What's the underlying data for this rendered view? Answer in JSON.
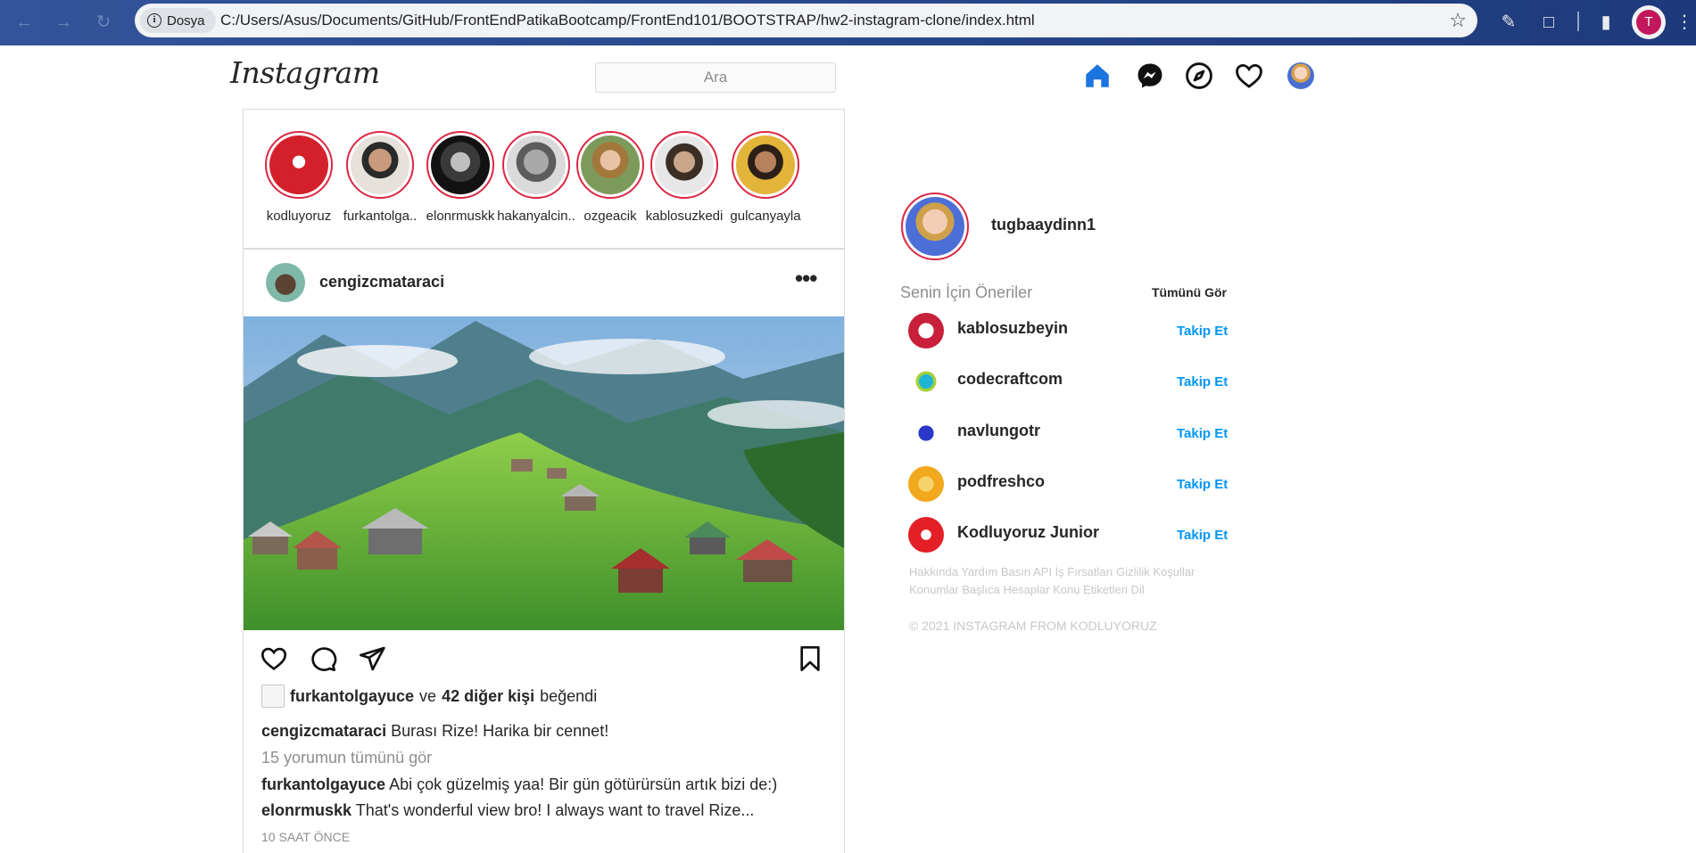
{
  "browser": {
    "site_chip": "Dosya",
    "url": "C:/Users/Asus/Documents/GitHub/FrontEndPatikaBootcamp/FrontEnd101/BOOTSTRAP/hw2-instagram-clone/index.html",
    "profile_initial": "T"
  },
  "header": {
    "logo": "Instagram",
    "search_placeholder": "Ara",
    "icons": [
      "home-icon",
      "messenger-icon",
      "explore-icon",
      "heart-icon",
      "profile-avatar"
    ]
  },
  "stories": [
    {
      "name": "kodluyoruz",
      "color": "#d4202a"
    },
    {
      "name": "furkantolga..",
      "color": "#9a8b7a"
    },
    {
      "name": "elonrmuskk",
      "color": "#2b2b2b"
    },
    {
      "name": "hakanyalcin..",
      "color": "#7d7d7d"
    },
    {
      "name": "ozgeacik",
      "color": "#8fa56a"
    },
    {
      "name": "kablosuzkedi",
      "color": "#6b5a4b"
    },
    {
      "name": "gulcanyayla",
      "color": "#c9a23a"
    }
  ],
  "post": {
    "user": "cengizcmataraci",
    "likes": {
      "user": "furkantolgayuce",
      "connector": "ve",
      "others": "42 diğer kişi",
      "suffix": "beğendi"
    },
    "caption": {
      "user": "cengizcmataraci",
      "text": "Burası Rize! Harika bir cennet!"
    },
    "view_all": "15 yorumun tümünü gör",
    "comments": [
      {
        "user": "furkantolgayuce",
        "text": "Abi çok güzelmiş yaa! Bir gün götürürsün artık bizi de:)"
      },
      {
        "user": "elonrmuskk",
        "text": "That's wonderful view bro! I always want to travel Rize..."
      }
    ],
    "time": "10 SAAT ÖNCE"
  },
  "sidebar": {
    "username": "tugbaaydinn1",
    "suggestions_title": "Senin İçin Öneriler",
    "see_all": "Tümünü Gör",
    "follow_label": "Takip Et",
    "suggestions": [
      {
        "name": "kablosuzbeyin",
        "color": "#c8203a"
      },
      {
        "name": "codecraftcom",
        "color": "#1fb5d4"
      },
      {
        "name": "navlungotr",
        "color": "#2a38c9"
      },
      {
        "name": "podfreshco",
        "color": "#f2a81d"
      },
      {
        "name": "Kodluyoruz Junior",
        "color": "#e41f26"
      }
    ],
    "footer_links": "Hakkında Yardım Basın API İş Fırsatları Gizlilik Koşullar Konumlar Başlıca Hesaplar Konu Etiketleri Dil",
    "copyright": "© 2021 INSTAGRAM FROM KODLUYORUZ"
  }
}
